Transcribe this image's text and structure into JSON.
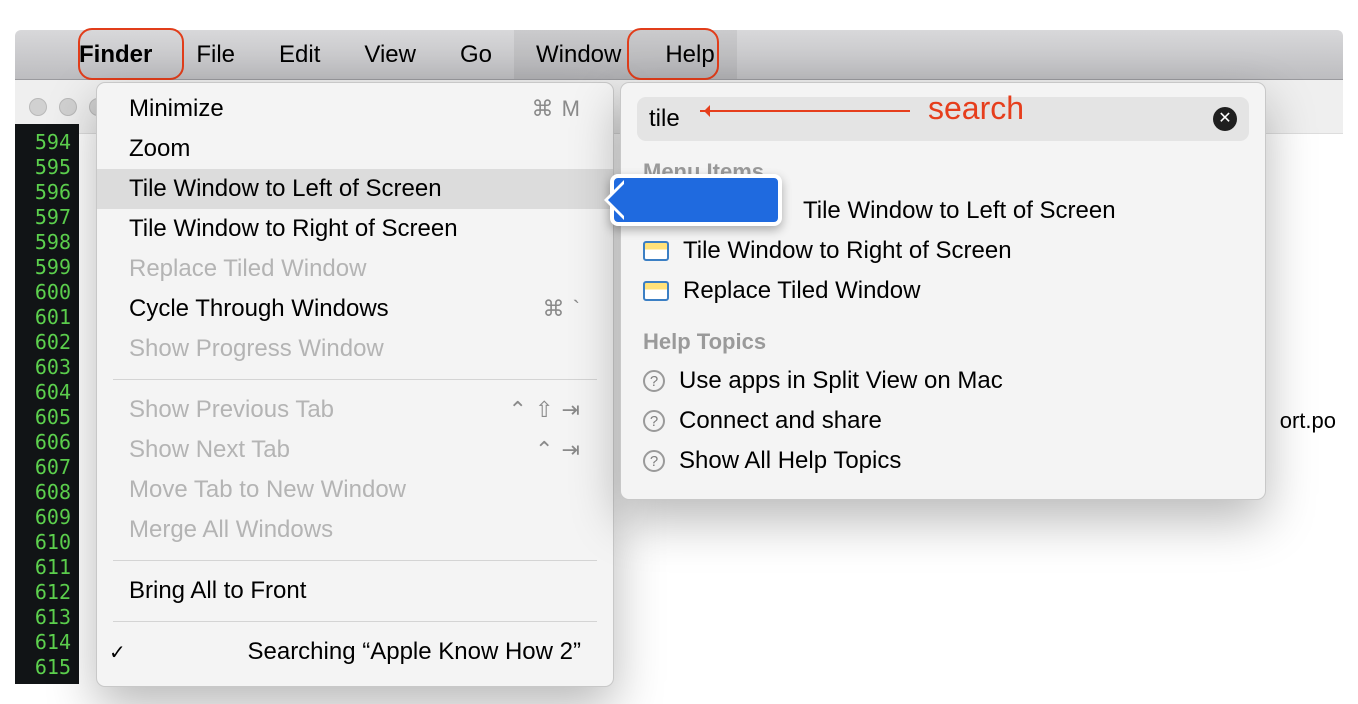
{
  "menubar": {
    "app": "Finder",
    "items": [
      "File",
      "Edit",
      "View",
      "Go",
      "Window",
      "Help"
    ]
  },
  "window_menu": {
    "minimize": {
      "label": "Minimize",
      "shortcut": "⌘ M"
    },
    "zoom": {
      "label": "Zoom"
    },
    "tile_left": {
      "label": "Tile Window to Left of Screen"
    },
    "tile_right": {
      "label": "Tile Window to Right of Screen"
    },
    "replace": {
      "label": "Replace Tiled Window"
    },
    "cycle": {
      "label": "Cycle Through Windows",
      "shortcut": "⌘ `"
    },
    "progress": {
      "label": "Show Progress Window"
    },
    "prev_tab": {
      "label": "Show Previous Tab",
      "shortcut": "⌃ ⇧ ⇥"
    },
    "next_tab": {
      "label": "Show Next Tab",
      "shortcut": "⌃ ⇥"
    },
    "move_tab": {
      "label": "Move Tab to New Window"
    },
    "merge": {
      "label": "Merge All Windows"
    },
    "bring": {
      "label": "Bring All to Front"
    },
    "searching": {
      "label": "Searching “Apple Know How 2”"
    }
  },
  "help": {
    "query": "tile",
    "sections": {
      "menu_items": "Menu Items",
      "help_topics": "Help Topics"
    },
    "menu_results": [
      "Tile Window to Left of Screen",
      "Tile Window to Right of Screen",
      "Replace Tiled Window"
    ],
    "topic_results": [
      "Use apps in Split View on Mac",
      "Connect and share",
      "Show All Help Topics"
    ]
  },
  "annotation": {
    "search_label": "search"
  },
  "gutter_lines": [
    "594",
    "595",
    "596",
    "597",
    "598",
    "599",
    "600",
    "601",
    "602",
    "603",
    "604",
    "605",
    "606",
    "607",
    "608",
    "609",
    "610",
    "611",
    "612",
    "613",
    "614",
    "615"
  ],
  "peek_text": "ort.po"
}
